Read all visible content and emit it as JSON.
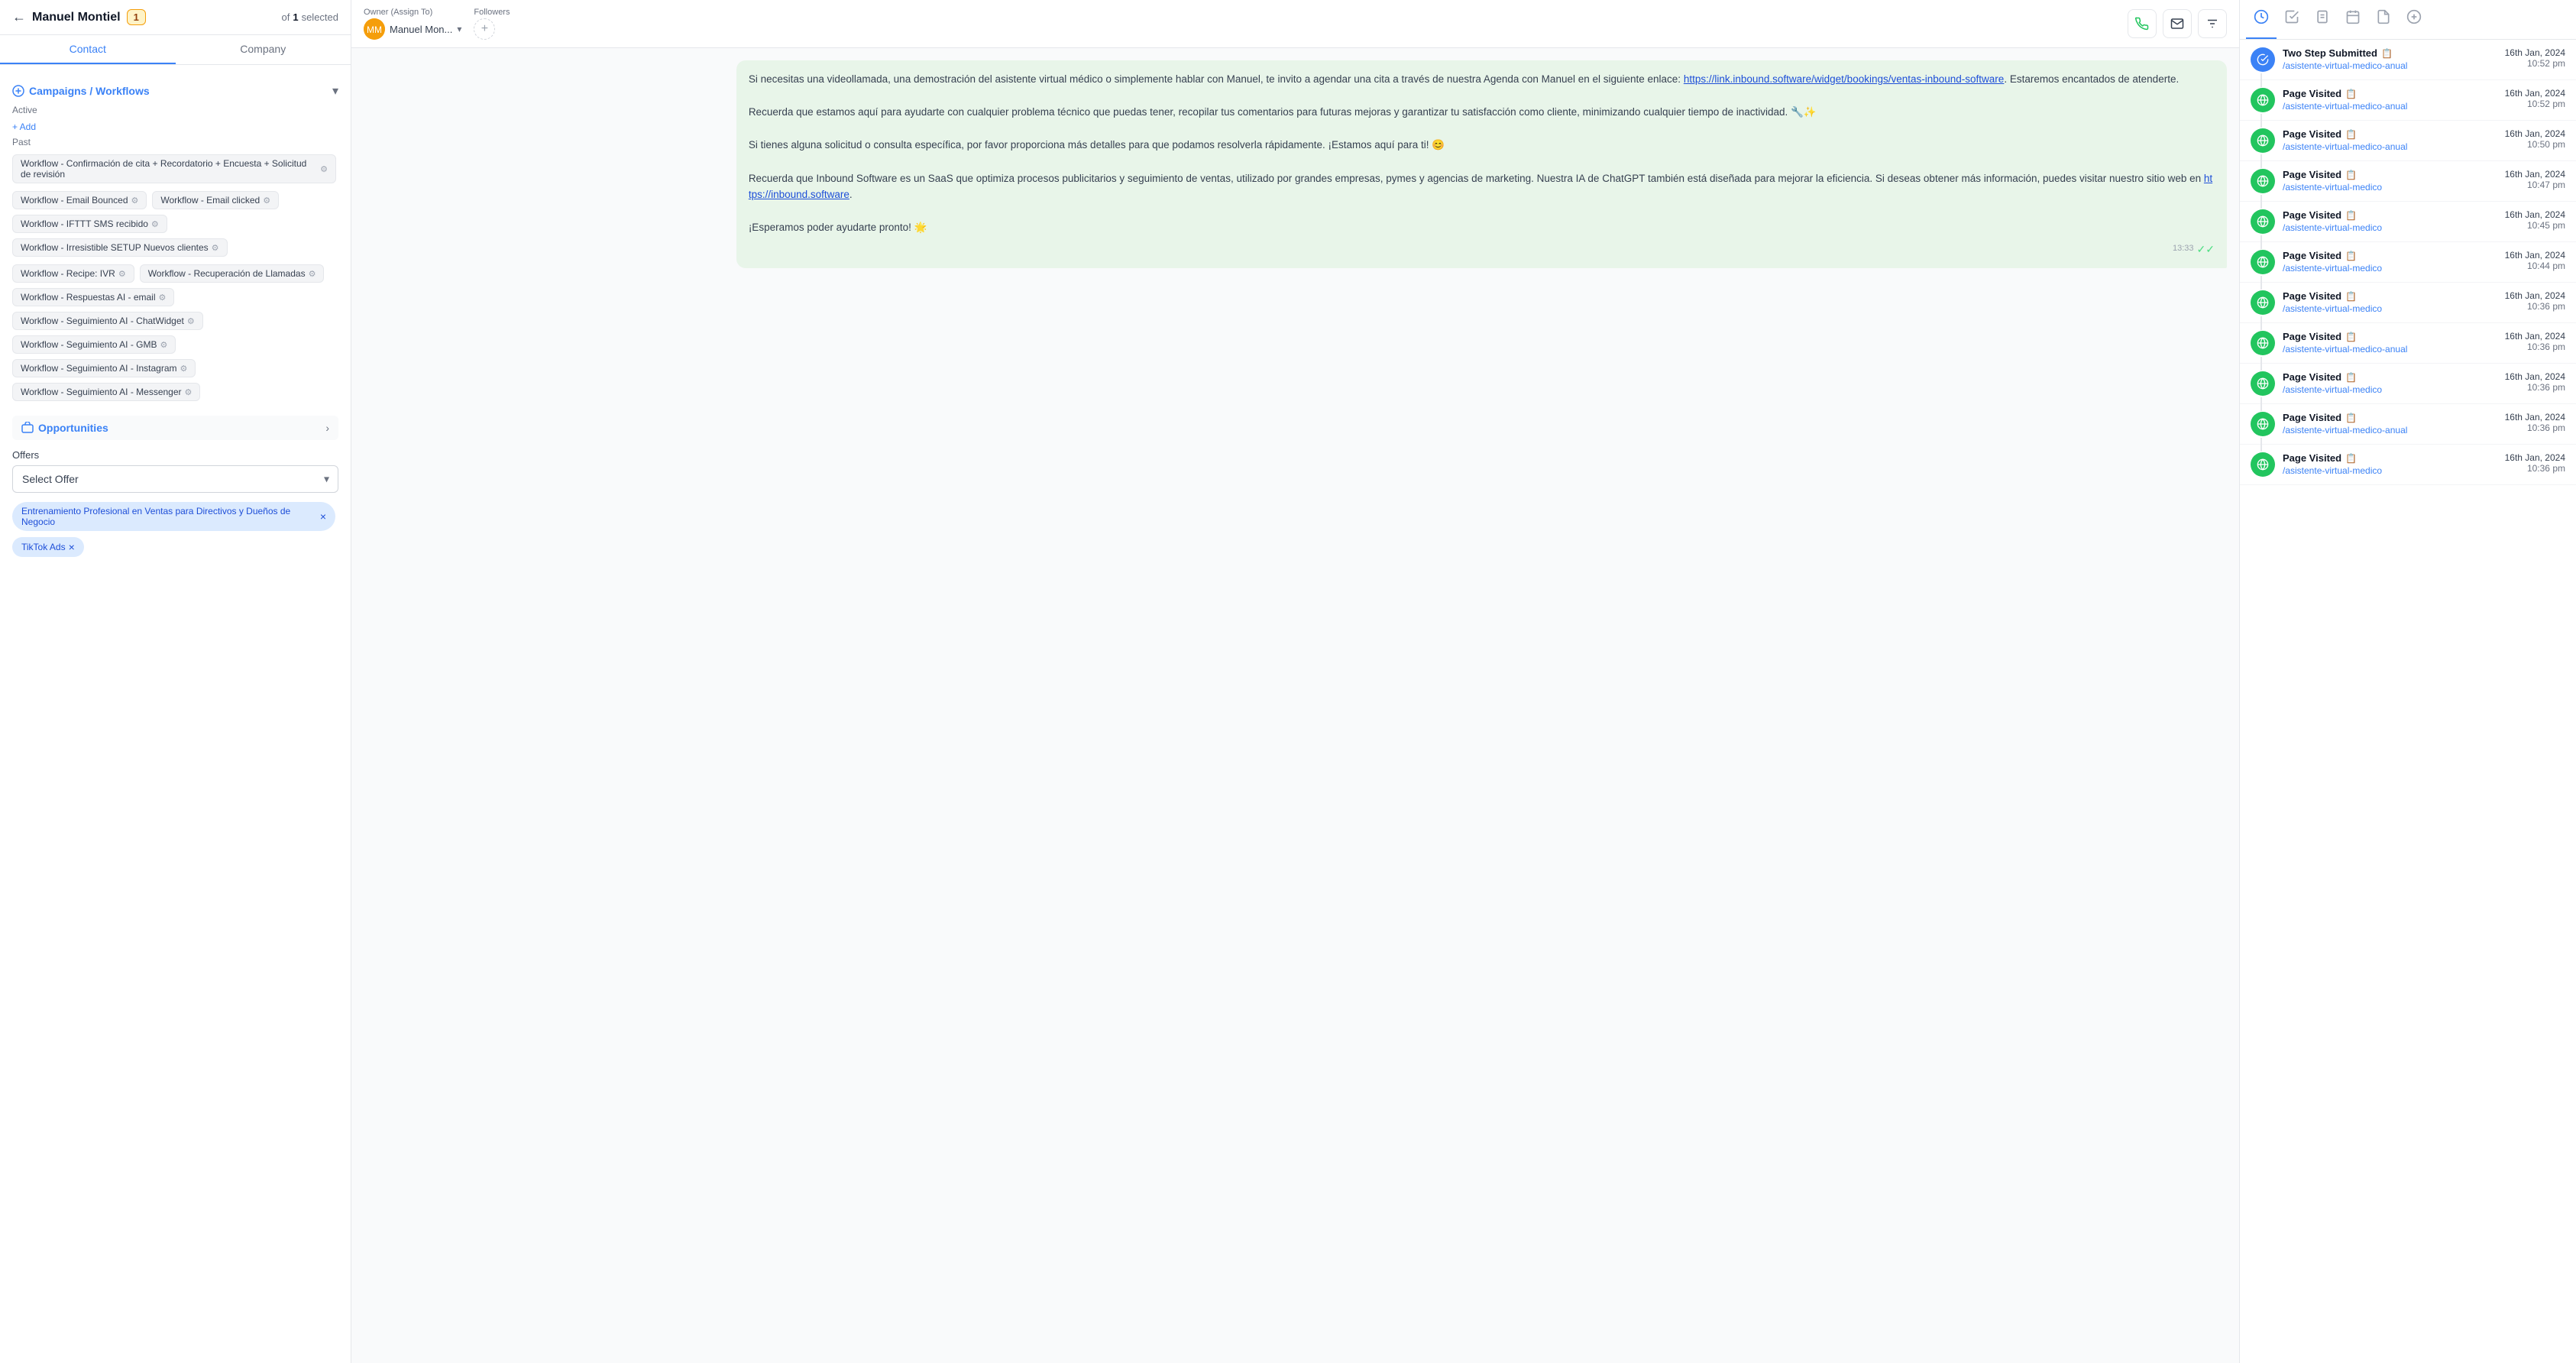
{
  "header": {
    "back_label": "←",
    "contact_name": "Manuel Montiel",
    "badge": "1",
    "selection_of": "of",
    "selection_count": "1",
    "selection_label": "selected"
  },
  "tabs": {
    "contact": "Contact",
    "company": "Company"
  },
  "campaigns": {
    "title": "Campaigns / Workflows",
    "active_label": "Active",
    "add_label": "+ Add",
    "past_label": "Past",
    "past_items": [
      {
        "label": "Workflow - Confirmación de cita + Recordatorio + Encuesta + Solicitud de revisión",
        "has_icon": true
      },
      {
        "label": "Workflow - Email Bounced",
        "has_icon": true
      },
      {
        "label": "Workflow - Email clicked",
        "has_icon": true
      },
      {
        "label": "Workflow - IFTTT SMS recibido",
        "has_icon": true
      },
      {
        "label": "Workflow - Irresistible SETUP Nuevos clientes",
        "has_icon": true
      },
      {
        "label": "Workflow - Recipe: IVR",
        "has_icon": true
      },
      {
        "label": "Workflow - Recuperación de Llamadas",
        "has_icon": true
      },
      {
        "label": "Workflow - Respuestas AI - email",
        "has_icon": true
      },
      {
        "label": "Workflow - Seguimiento AI - ChatWidget",
        "has_icon": true
      },
      {
        "label": "Workflow - Seguimiento AI - GMB",
        "has_icon": true
      },
      {
        "label": "Workflow - Seguimiento AI - Instagram",
        "has_icon": true
      },
      {
        "label": "Workflow - Seguimiento AI - Messenger",
        "has_icon": true
      }
    ]
  },
  "opportunities": {
    "title": "Opportunities",
    "offers_label": "Offers",
    "select_placeholder": "Select Offer",
    "selected_offers": [
      {
        "label": "Entrenamiento Profesional en Ventas para Directivos y Dueños de Negocio"
      },
      {
        "label": "TikTok Ads"
      }
    ]
  },
  "chat": {
    "owner_label": "Owner (Assign To)",
    "owner_name": "Manuel Mon...",
    "followers_label": "Followers",
    "message": "Si necesitas una videollamada, una demostración del asistente virtual médico o simplemente hablar con Manuel, te invito a agendar una cita a través de nuestra Agenda con Manuel en el siguiente enlace: https://link.inbound.software/widget/bookings/ventas-inbound-software. Estaremos encantados de atenderte.\n\nRecuerda que estamos aquí para ayudarte con cualquier problema técnico que puedas tener, recopilar tus comentarios para futuras mejoras y garantizar tu satisfacción como cliente, minimizando cualquier tiempo de inactividad. 🔧✨\n\nSi tienes alguna solicitud o consulta específica, por favor proporciona más detalles para que podamos resolverla rápidamente. ¡Estamos aquí para ti! 😊\n\nRecuerda que Inbound Software es un SaaS que optimiza procesos publicitarios y seguimiento de ventas, utilizado por grandes empresas, pymes y agencias de marketing. Nuestra IA de ChatGPT también está diseñada para mejorar la eficiencia. Si deseas obtener más información, puedes visitar nuestro sitio web en https://inbound.software.\n\n¡Esperamos poder ayudarte pronto! 🌟",
    "link1": "https://link.inbound.software/widget/bookings/ventas-inbound-software",
    "link2": "https://inbound.software",
    "timestamp": "13:33"
  },
  "activity": {
    "items": [
      {
        "type": "two-step",
        "icon_type": "blue",
        "title": "Two Step Submitted",
        "link": "/asistente-virtual-medico-anual",
        "date": "16th Jan, 2024",
        "time": "10:52 pm"
      },
      {
        "type": "page-visited",
        "icon_type": "green",
        "title": "Page Visited",
        "link": "/asistente-virtual-medico-anual",
        "date": "16th Jan, 2024",
        "time": "10:52 pm"
      },
      {
        "type": "page-visited",
        "icon_type": "green",
        "title": "Page Visited",
        "link": "/asistente-virtual-medico-anual",
        "date": "16th Jan, 2024",
        "time": "10:50 pm"
      },
      {
        "type": "page-visited",
        "icon_type": "green",
        "title": "Page Visited",
        "link": "/asistente-virtual-medico",
        "date": "16th Jan, 2024",
        "time": "10:47 pm"
      },
      {
        "type": "page-visited",
        "icon_type": "green",
        "title": "Page Visited",
        "link": "/asistente-virtual-medico",
        "date": "16th Jan, 2024",
        "time": "10:45 pm"
      },
      {
        "type": "page-visited",
        "icon_type": "green",
        "title": "Page Visited",
        "link": "/asistente-virtual-medico",
        "date": "16th Jan, 2024",
        "time": "10:44 pm"
      },
      {
        "type": "page-visited",
        "icon_type": "green",
        "title": "Page Visited",
        "link": "/asistente-virtual-medico",
        "date": "16th Jan, 2024",
        "time": "10:36 pm"
      },
      {
        "type": "page-visited",
        "icon_type": "green",
        "title": "Page Visited",
        "link": "/asistente-virtual-medico-anual",
        "date": "16th Jan, 2024",
        "time": "10:36 pm"
      },
      {
        "type": "page-visited",
        "icon_type": "green",
        "title": "Page Visited",
        "link": "/asistente-virtual-medico",
        "date": "16th Jan, 2024",
        "time": "10:36 pm"
      },
      {
        "type": "page-visited",
        "icon_type": "green",
        "title": "Page Visited",
        "link": "/asistente-virtual-medico-anual",
        "date": "16th Jan, 2024",
        "time": "10:36 pm"
      },
      {
        "type": "page-visited",
        "icon_type": "green",
        "title": "Page Visited",
        "link": "/asistente-virtual-medico",
        "date": "16th Jan, 2024",
        "time": "10:36 pm"
      }
    ]
  }
}
